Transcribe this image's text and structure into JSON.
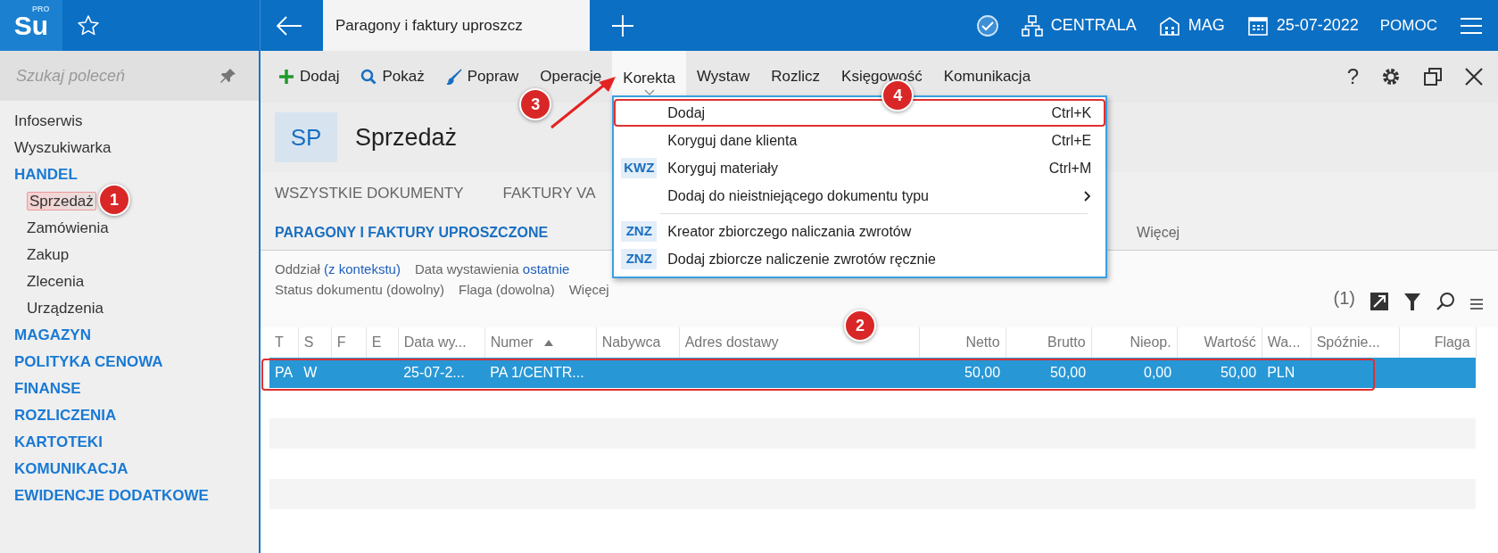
{
  "top_bar": {
    "logo": "Su",
    "logo_sup": "PRO",
    "tab_title": "Paragony i faktury uproszcz",
    "context": [
      {
        "kind": "check"
      },
      {
        "kind": "org",
        "label": "CENTRALA"
      },
      {
        "kind": "store",
        "label": "MAG"
      },
      {
        "kind": "date",
        "label": "25-07-2022"
      },
      {
        "kind": "text",
        "label": "POMOC"
      }
    ]
  },
  "sidebar": {
    "placeholder": "Szukaj poleceń",
    "items": [
      {
        "label": "Infoserwis",
        "kind": "link"
      },
      {
        "label": "Wyszukiwarka",
        "kind": "link"
      },
      {
        "label": "HANDEL",
        "kind": "group",
        "children": [
          {
            "label": "Sprzedaż",
            "selected": true,
            "callout": "1"
          },
          {
            "label": "Zamówienia",
            "selected": false
          },
          {
            "label": "Zakup",
            "selected": false
          },
          {
            "label": "Zlecenia",
            "selected": false
          },
          {
            "label": "Urządzenia",
            "selected": false
          }
        ]
      },
      {
        "label": "MAGAZYN",
        "kind": "group"
      },
      {
        "label": "POLITYKA CENOWA",
        "kind": "group"
      },
      {
        "label": "FINANSE",
        "kind": "group"
      },
      {
        "label": "ROZLICZENIA",
        "kind": "group"
      },
      {
        "label": "KARTOTEKI",
        "kind": "group"
      },
      {
        "label": "KOMUNIKACJA",
        "kind": "group"
      },
      {
        "label": "EWIDENCJE DODATKOWE",
        "kind": "group"
      }
    ]
  },
  "toolbar": {
    "actions": [
      {
        "label": "Dodaj",
        "kind": "add",
        "open": false
      },
      {
        "label": "Pokaż",
        "kind": "show",
        "open": false
      },
      {
        "label": "Popraw",
        "kind": "edit",
        "open": false
      },
      {
        "label": "Operacje",
        "kind": "plain",
        "open": false
      },
      {
        "label": "Korekta",
        "kind": "plain",
        "open": true,
        "callout": "3"
      },
      {
        "label": "Wystaw",
        "kind": "plain",
        "open": false
      },
      {
        "label": "Rozlicz",
        "kind": "plain",
        "open": false
      },
      {
        "label": "Księgowość",
        "kind": "plain",
        "open": false
      },
      {
        "label": "Komunikacja",
        "kind": "plain",
        "open": false
      }
    ],
    "help": "?"
  },
  "menu": {
    "callout": "4",
    "items": [
      {
        "kind": "entry",
        "label": "Dodaj",
        "shortcut": "Ctrl+K",
        "outlined": true,
        "submenu": false
      },
      {
        "kind": "entry",
        "label": "Koryguj dane klienta",
        "shortcut": "Ctrl+E",
        "outlined": false,
        "submenu": false
      },
      {
        "kind": "entry",
        "tag": "KWZ",
        "label": "Koryguj materiały",
        "shortcut": "Ctrl+M",
        "outlined": false,
        "submenu": false
      },
      {
        "kind": "entry",
        "label": "Dodaj do nieistniejącego dokumentu typu",
        "outlined": false,
        "submenu": true
      },
      {
        "kind": "separator"
      },
      {
        "kind": "entry",
        "tag": "ZNZ",
        "label": "Kreator zbiorczego naliczania zwrotów",
        "outlined": false,
        "submenu": false
      },
      {
        "kind": "entry",
        "tag": "ZNZ",
        "label": "Dodaj zbiorcze naliczenie zwrotów ręcznie",
        "outlined": false,
        "submenu": false
      }
    ]
  },
  "module": {
    "code": "SP",
    "title": "Sprzedaż"
  },
  "tabs": [
    {
      "label": "WSZYSTKIE DOKUMENTY",
      "selected": false
    },
    {
      "label": "FAKTURY VA",
      "selected": false
    }
  ],
  "subtabs": [
    {
      "label": "PARAGONY I FAKTURY UPROSZCZONE",
      "selected": true
    },
    {
      "label": "Więcej",
      "selected": false
    }
  ],
  "filters": [
    [
      {
        "label": "Oddział",
        "value": "(z kontekstu)"
      },
      {
        "label": "Data wystawienia",
        "value": "ostatnie"
      }
    ],
    [
      {
        "label": "Status dokumentu (dowolny)"
      },
      {
        "label": "Flaga (dowolna)"
      },
      {
        "label": "Więcej"
      }
    ]
  ],
  "grid": {
    "count": "(1)",
    "columns": [
      {
        "label": "T",
        "sorted": false
      },
      {
        "label": "S",
        "sorted": false
      },
      {
        "label": "F",
        "sorted": false
      },
      {
        "label": "E",
        "sorted": false
      },
      {
        "label": "Data wy...",
        "sorted": false
      },
      {
        "label": "Numer",
        "sorted": true
      },
      {
        "label": "Nabywca",
        "sorted": false
      },
      {
        "label": "Adres dostawy",
        "sorted": false
      },
      {
        "label": "Netto",
        "sorted": false
      },
      {
        "label": "Brutto",
        "sorted": false
      },
      {
        "label": "Nieop.",
        "sorted": false
      },
      {
        "label": "Wartość",
        "sorted": false
      },
      {
        "label": "Wa...",
        "sorted": false
      },
      {
        "label": "Spóźnie...",
        "sorted": false
      },
      {
        "label": "Flaga",
        "sorted": false
      }
    ],
    "rows": [
      {
        "selected": true,
        "outlined": true,
        "callout": "2",
        "cells": [
          "PA",
          "W",
          "",
          "",
          "25-07-2...",
          "PA 1/CENTR...",
          "",
          "",
          "50,00",
          "50,00",
          "0,00",
          "50,00",
          "PLN",
          "",
          ""
        ]
      }
    ]
  }
}
